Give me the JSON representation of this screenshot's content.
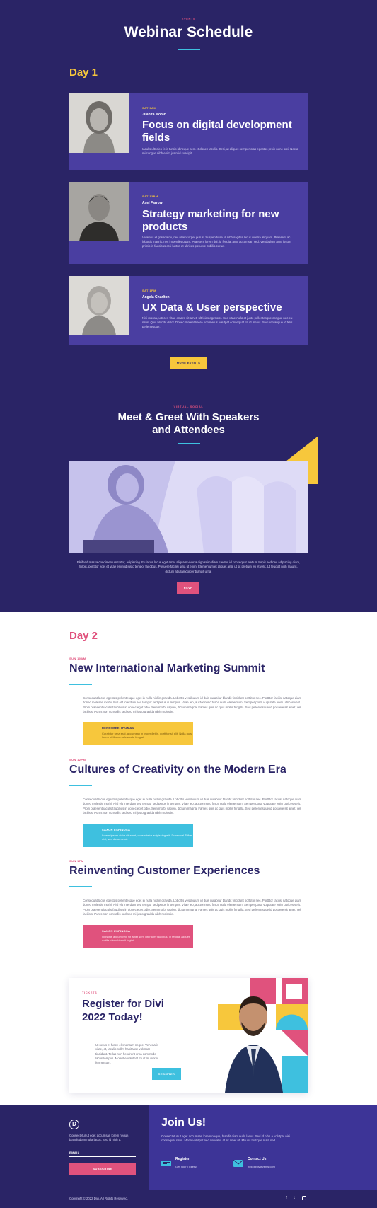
{
  "header": {
    "eyebrow": "EVENTS",
    "title": "Webinar Schedule"
  },
  "day1": {
    "label": "Day 1",
    "sessions": [
      {
        "time": "SAT 9AM",
        "speaker": "Juanita Moran",
        "title": "Focus on digital development fields",
        "desc": "Iaculis ultricies felis turpis id neque sem et donec iaculis. Orci, ut aliquet semper cras egestas proin nunc orci. Nec a mi congue nibh enim justo id suscipit."
      },
      {
        "time": "SAT 12PM",
        "speaker": "Axel Farrow",
        "title": "Strategy marketing for new products",
        "desc": "Vivamus id gravida mi, nec ullamcorper purus. Suspendisse ut nibh sagittis lacus viverra aliquam. Praesent ac lobortis mauris, nec imperdiet quam. Praesent lorem dui, id feugiat ante accumsan sed. Vestibulum ante ipsum primis in faucibus orci luctus et ultrices posuere cubilia curae."
      },
      {
        "time": "SAT 1PM",
        "speaker": "Angela Charlton",
        "title": "UX Data & User perspective",
        "desc": "Nisi massa, ultrices vitae ornare sit amet, ultricies eget orci. Sed vitae nulla et justo pellentesque congue nec eu risus. Quis blandit dolor. Donec laoreet libero non metus volutpat consequat. In id metus. Sed non augue id felis pellentesque."
      }
    ],
    "more_button": "MORE EVENTS"
  },
  "social": {
    "eyebrow": "VIRTUAL SOCIAL",
    "title_line1": "Meet & Greet With Speakers",
    "title_line2": "and Attendees",
    "text": "Eleifend massa condimentum tortor, adipiscing. Eu lacus lacus eget amet aliquam viverra dignissim diam. Lectus id consequat pretium turpis sed nec adipiscing diam, turpis, porttitor eget et vitae enim id justo tempor faucibus. Posuere facilisi urna ut enim. Elementum et aliquet ante ut sit pretium eu et velit. Ut feugiat nibh mauris, dictum at ullamcorper blandit urna.",
    "button": "RSVP"
  },
  "day2": {
    "label": "Day 2",
    "sessions": [
      {
        "time": "SUN 10AM",
        "title": "New International Marketing Summit",
        "body": "Consequat lacus egestas pellentesque eget in nulla nisl in gravida. Lobortis vestibulum id duis curabitur blandit tincidunt porttitor nec. Porttitor facilisi natoque diam donec molestie morbi. Nisl elit interdum sed tempor sed purus in tempus. Vitae leo, auctor nunc fusce nulla elementum. Semper porta vulputate enim ultrices velit. Proin praesent iaculis faucibus in donec eget odio. Sem morbi sapien, dictum magna. Fames quis ac quis mollis fringilla. Sed pellentesque id posuere sit amet, vel facilisis. Purus non convallis sed sed mi justo gravida nibh molestie.",
        "quote_name": "RENESMEE THOMAS",
        "quote_text": "Curabitur urna erat, accumsan in imperdiet in, porttitor sit elit. Nulla quis lorem ut libero malesuada feugiat."
      },
      {
        "time": "SUN 12PM",
        "title": "Cultures of Creativity on the Modern Era",
        "body": "Consequat lacus egestas pellentesque eget in nulla nisl in gravida. Lobortis vestibulum id duis curabitur blandit tincidunt porttitor nec. Porttitor facilisi natoque diam donec molestie morbi. Nisl elit interdum sed tempor sed purus in tempus. Vitae leo, auctor nunc fusce nulla elementum. Semper porta vulputate enim ultrices velit. Proin praesent iaculis faucibus in donec eget odio. Sem morbi sapien, dictum magna. Fames quis ac quis mollis fringilla. Sed pellentesque id posuere sit amet, vel facilisis. Purus non convallis sed sed mi justo gravida nibh molestie.",
        "quote_name": "SAXON ESPINOSA",
        "quote_text": "Lorem ipsum dolor sit amet, consectetur adipiscing elit. Donec vel Tellus nisi, sed dictum erat."
      },
      {
        "time": "SUN 1PM",
        "title": "Reinventing Customer Experiences",
        "body": "Consequat lacus egestas pellentesque eget in nulla nisl in gravida. Lobortis vestibulum id duis curabitur blandit tincidunt porttitor nec. Porttitor facilisi natoque diam donec molestie morbi. Nisl elit interdum sed tempor sed purus in tempus. Vitae leo, auctor nunc fusce nulla elementum. Semper porta vulputate enim ultrices velit. Proin praesent iaculis faucibus in donec eget odio. Sem morbi sapien, dictum magna. Fames quis ac quis mollis fringilla. Sed pellentesque id posuere sit amet, vel facilisis. Purus non convallis sed sed mi justo gravida nibh molestie.",
        "quote_name": "SAXON ESPINOSA",
        "quote_text": "Quisque aliquet velit sit amet sem interdum faucibus. In feugiat aliquet mollis etiam blandit fugiat."
      }
    ]
  },
  "register": {
    "eyebrow": "TICKETS",
    "title_line1": "Register for Divi",
    "title_line2": "2022 Today!",
    "text": "Ut netus et fusce elementum neque. Venenatis vitae, et, iaculis nullm habitasse volutpat tincidunt. Tellus non hendrerit urna commodo lacus tempus. Molestie volutpat mi ut mi morbi fermentum.",
    "button": "REGISTER"
  },
  "footer": {
    "logo_letter": "D",
    "about": "Consectetur ut eget accumsan lorem neque, blandit diam nulla lacus. Sed id nibh a.",
    "email_label": "EMAIL",
    "subscribe": "SUBSCRIBE",
    "join_title": "Join Us!",
    "join_text": "Consectetur ut eget accumsan lorem neque, blandit diam nulla lacus. Sed id nibh a volutpat nisi consequat risus. Morbi volutpat nec convallis at sit amet ut. Mauris tristique nulla sed.",
    "items": [
      {
        "title": "Register",
        "sub": "Get Your Tickets!"
      },
      {
        "title": "Contact Us",
        "sub": "hello@divievents.com"
      }
    ],
    "copyright": "Copyright © 2022 Divi. All Rights Reserved.",
    "social": [
      "f",
      "t",
      "ig"
    ]
  },
  "colors": {
    "navy": "#2a2466",
    "card": "#4a3ea1",
    "yellow": "#f7c73c",
    "pink": "#e0527d",
    "blue": "#3ec0df"
  }
}
